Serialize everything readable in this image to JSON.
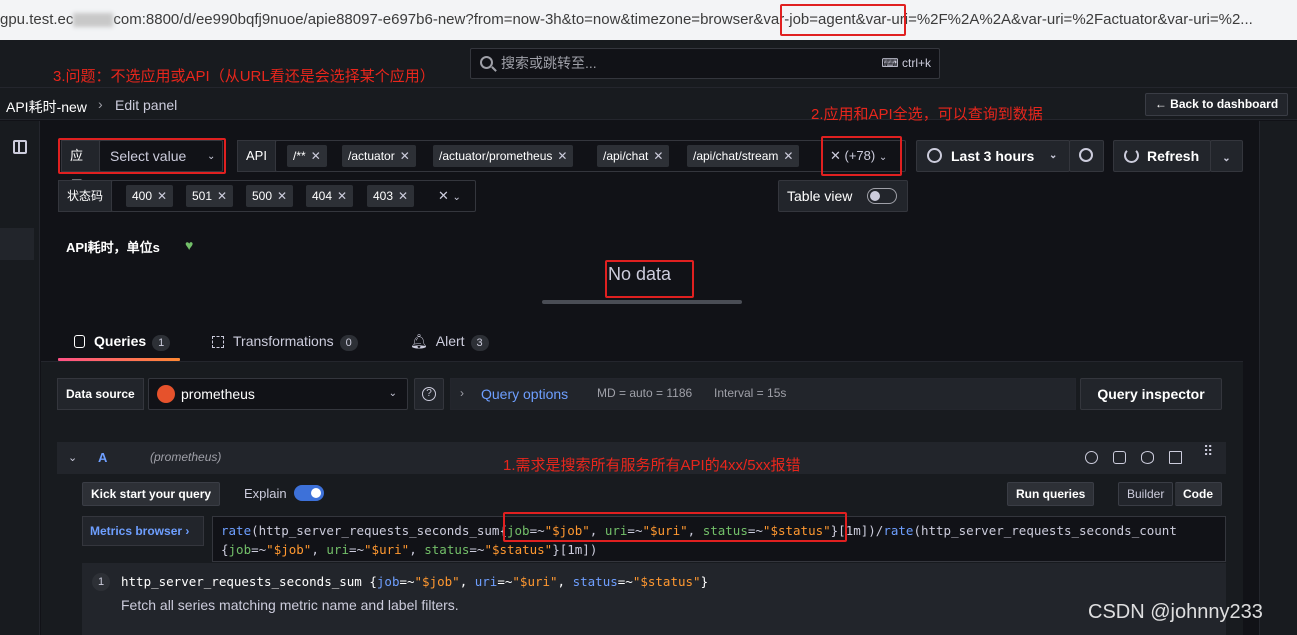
{
  "browser": {
    "url_prefix": "gpu.test.ec",
    "url_main": "com:8800/d/ee990bqfj9nuoe/apie88097-e697b6-new?from=now-3h&to=now&timezone=browser",
    "url_highlight": "&var-job=agent&",
    "url_tail": "var-uri=%2F%2A%2A&var-uri=%2Factuator&var-uri=%2..."
  },
  "annotations": {
    "issue3": "3.问题：不选应用或API（从URL看还是会选择某个应用）",
    "issue2": "2.应用和API全选，可以查询到数据",
    "issue1": "1.需求是搜索所有服务所有API的4xx/5xx报错"
  },
  "topbar": {
    "search_placeholder": "搜索或跳转至...",
    "shortcut": "ctrl+k"
  },
  "breadcrumb": {
    "dashboard": "API耗时-new",
    "page": "Edit panel",
    "back_label": "Back to dashboard"
  },
  "variables": {
    "app": {
      "label": "应用",
      "value": "Select value"
    },
    "api": {
      "label": "API",
      "chips": [
        "/**",
        "/actuator",
        "/actuator/prometheus",
        "/api/chat",
        "/api/chat/stream"
      ],
      "more": "(+78)"
    },
    "status": {
      "label": "状态码",
      "chips": [
        "400",
        "501",
        "500",
        "404",
        "403"
      ]
    }
  },
  "toolbar": {
    "time_range": "Last 3 hours",
    "refresh": "Refresh",
    "table_view": "Table view"
  },
  "panel": {
    "title": "API耗时，单位s",
    "empty": "No data"
  },
  "tabs": [
    {
      "label": "Queries",
      "count": "1"
    },
    {
      "label": "Transformations",
      "count": "0"
    },
    {
      "label": "Alert",
      "count": "3"
    }
  ],
  "datasource": {
    "label": "Data source",
    "name": "prometheus",
    "options_title": "Query options",
    "md": "MD = auto = 1186",
    "interval": "Interval = 15s",
    "inspector": "Query inspector"
  },
  "query": {
    "ref_id": "A",
    "ds_hint": "(prometheus)",
    "kickstart": "Kick start your query",
    "explain": "Explain",
    "run": "Run queries",
    "mode_builder": "Builder",
    "mode_code": "Code",
    "metrics_browser": "Metrics browser ›",
    "suggestion_index": "1",
    "suggestion_metric": "http_server_requests_seconds_sum",
    "suggestion_desc": "Fetch all series matching metric name and label filters."
  },
  "watermark": "CSDN @johnny233",
  "colors": {
    "accent_blue": "#6e9fff",
    "annotation_red": "#e8261c",
    "label_green": "#73bf69",
    "string_orange": "#ff9830"
  }
}
